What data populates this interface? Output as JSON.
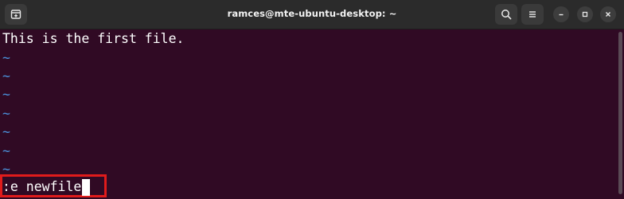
{
  "window": {
    "title": "ramces@mte-ubuntu-desktop: ~"
  },
  "icons": {
    "new_tab": "new-tab-icon",
    "search": "search-icon",
    "menu": "hamburger-menu-icon",
    "minimize": "minimize-icon",
    "maximize": "maximize-icon",
    "close": "close-icon"
  },
  "terminal": {
    "lines": [
      "This is the first file.",
      "~",
      "~",
      "~",
      "~",
      "~",
      "~",
      "~"
    ],
    "command": ":e newfile"
  },
  "colors": {
    "background": "#300a24",
    "tilde": "#4a90d9",
    "highlight": "#e01b1b"
  }
}
